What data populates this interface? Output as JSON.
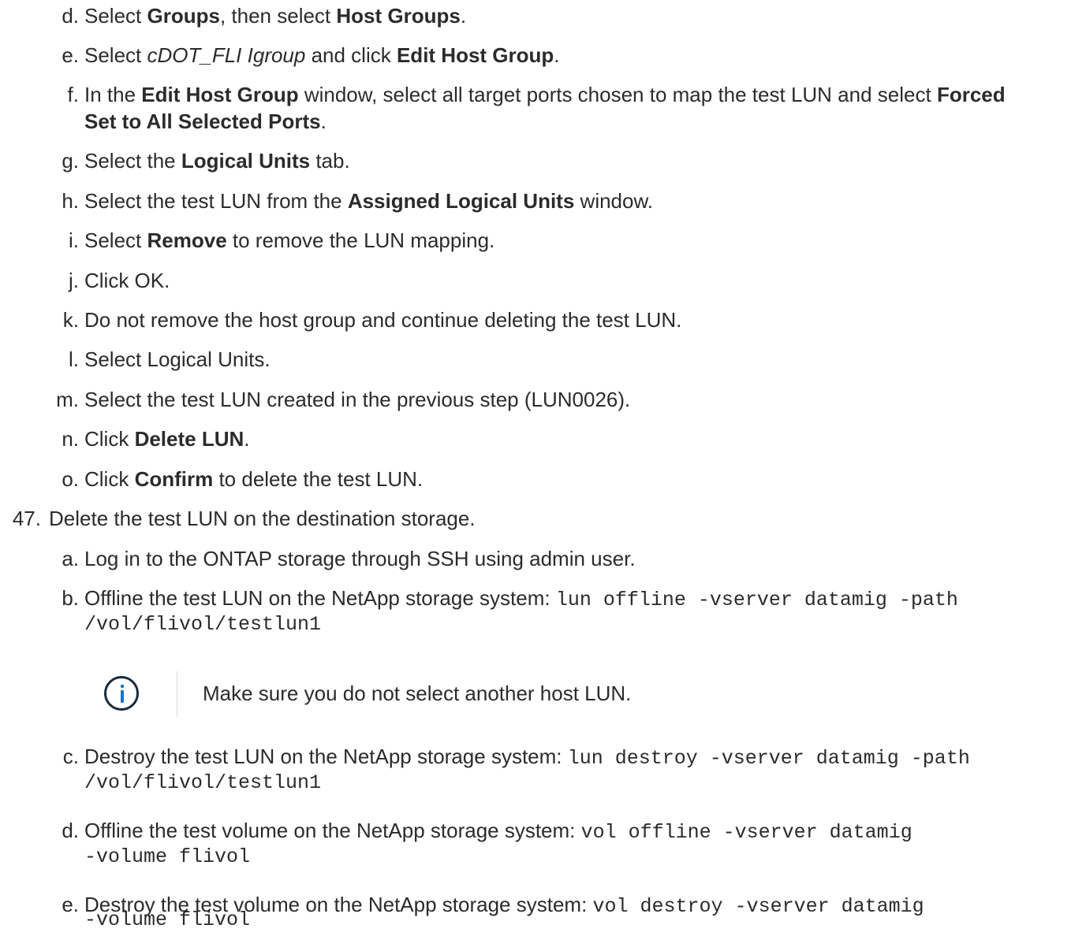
{
  "steps": {
    "d": {
      "marker": "d.",
      "t1": "Select ",
      "b1": "Groups",
      "t2": ", then select ",
      "b2": "Host Groups",
      "t3": "."
    },
    "e": {
      "marker": "e.",
      "t1": "Select ",
      "i1": "cDOT_FLI Igroup",
      "t2": " and click ",
      "b1": "Edit Host Group",
      "t3": "."
    },
    "f": {
      "marker": "f.",
      "t1": "In the ",
      "b1": "Edit Host Group",
      "t2": " window, select all target ports chosen to map the test LUN and select ",
      "b2": "Forced",
      "b3": "Set to All Selected Ports",
      "t3": "."
    },
    "g": {
      "marker": "g.",
      "t1": "Select the ",
      "b1": "Logical Units",
      "t2": " tab."
    },
    "h": {
      "marker": "h.",
      "t1": "Select the test LUN from the ",
      "b1": "Assigned Logical Units",
      "t2": " window."
    },
    "i": {
      "marker": "i.",
      "t1": "Select ",
      "b1": "Remove",
      "t2": " to remove the LUN mapping."
    },
    "j": {
      "marker": "j.",
      "t1": "Click OK."
    },
    "k": {
      "marker": "k.",
      "t1": "Do not remove the host group and continue deleting the test LUN."
    },
    "l": {
      "marker": "l.",
      "t1": "Select Logical Units."
    },
    "m": {
      "marker": "m.",
      "t1": "Select the test LUN created in the previous step (LUN0026)."
    },
    "n": {
      "marker": "n.",
      "t1": "Click ",
      "b1": "Delete LUN",
      "t2": "."
    },
    "o": {
      "marker": "o.",
      "t1": "Click ",
      "b1": "Confirm",
      "t2": " to delete the test LUN."
    }
  },
  "step47": {
    "marker": "47.",
    "text": "Delete the test LUN on the destination storage.",
    "a": {
      "marker": "a.",
      "t1": "Log in to the ONTAP storage through SSH using admin user."
    },
    "b": {
      "marker": "b.",
      "t1": "Offline the test LUN on the NetApp storage system: ",
      "c1": "lun offline -vserver datamig -path",
      "c2": "/vol/flivol/testlun1"
    },
    "note": {
      "icon": "info-icon",
      "text": "Make sure you do not select another host LUN."
    },
    "c": {
      "marker": "c.",
      "t1": "Destroy the test LUN on the NetApp storage system: ",
      "c1": "lun destroy -vserver datamig -path",
      "c2": "/vol/flivol/testlun1"
    },
    "d": {
      "marker": "d.",
      "t1": "Offline the test volume on the NetApp storage system: ",
      "c1": "vol offline -vserver datamig",
      "c2": "-volume flivol"
    },
    "e": {
      "marker": "e.",
      "t1": "Destroy the test volume on the NetApp storage system: ",
      "c1": "vol destroy -vserver datamig",
      "c2": "-volume flivol"
    }
  }
}
